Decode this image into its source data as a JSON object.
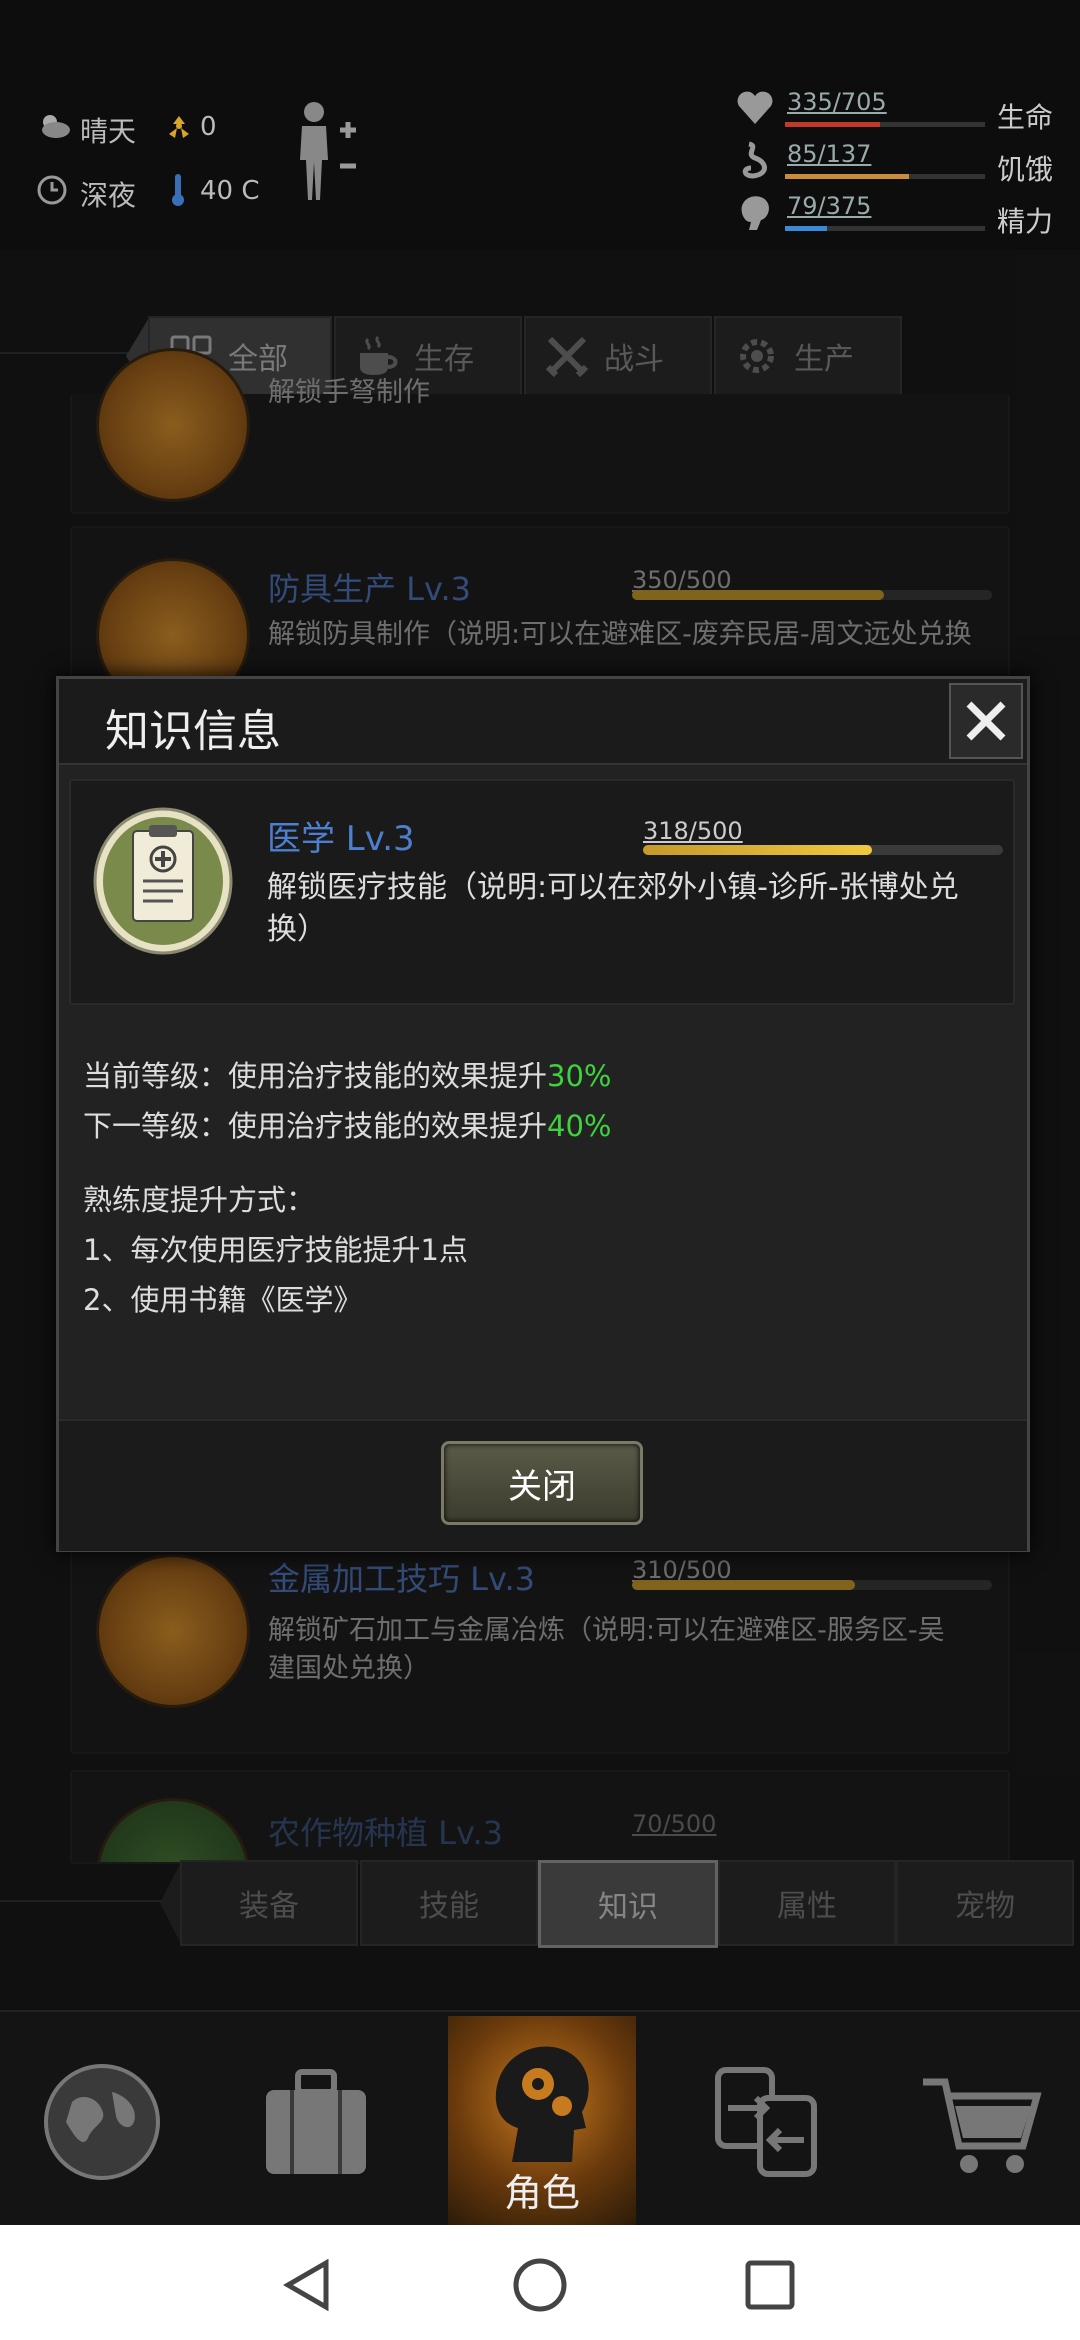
{
  "status": {
    "weather": "晴天",
    "radiation": "0",
    "time_of_day": "深夜",
    "temperature": "40 C"
  },
  "vitals": [
    {
      "value": "335/705",
      "name": "生命",
      "fraction": 0.475,
      "color": "#c0392b"
    },
    {
      "value": "85/137",
      "name": "饥饿",
      "fraction": 0.62,
      "color": "#c98a3b"
    },
    {
      "value": "79/375",
      "name": "精力",
      "fraction": 0.21,
      "color": "#3a8ad8"
    }
  ],
  "category_tabs": [
    "全部",
    "生存",
    "战斗",
    "生产"
  ],
  "background_cards": {
    "card_top_desc": "解锁手弩制作",
    "armor": {
      "title": "防具生产 Lv.3",
      "progress": "350/500",
      "fraction": 0.7,
      "desc": "解锁防具制作（说明:可以在避难区-废弃民居-周文远处兑换"
    },
    "metal": {
      "title": "金属加工技巧 Lv.3",
      "progress": "310/500",
      "fraction": 0.62,
      "desc": "解锁矿石加工与金属冶炼（说明:可以在避难区-服务区-吴建国处兑换）"
    },
    "crops": {
      "title": "农作物种植 Lv.3",
      "progress": "70/500"
    }
  },
  "modal": {
    "title": "知识信息",
    "skill_title": "医学 Lv.3",
    "skill_progress": "318/500",
    "skill_fraction": 0.636,
    "skill_desc": "解锁医疗技能（说明:可以在郊外小镇-诊所-张博处兑换）",
    "current_prefix": "当前等级：使用治疗技能的效果提升",
    "current_value": "30%",
    "next_prefix": "下一等级：使用治疗技能的效果提升",
    "next_value": "40%",
    "method_heading": "熟练度提升方式：",
    "method_1": "1、每次使用医疗技能提升1点",
    "method_2": "2、使用书籍《医学》",
    "close_label": "关闭"
  },
  "bottom_tabs": [
    "装备",
    "技能",
    "知识",
    "属性",
    "宠物"
  ],
  "bottom_nav": {
    "active_label": "角色"
  }
}
